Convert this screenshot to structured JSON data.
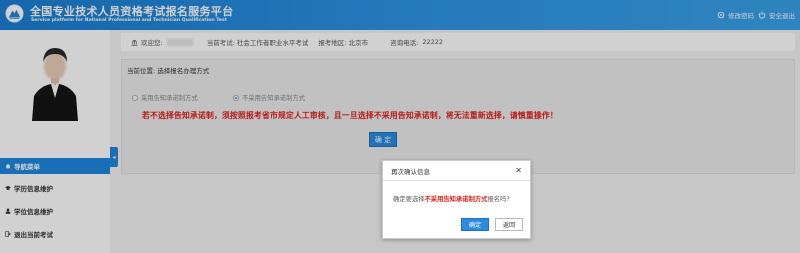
{
  "header": {
    "title": "全国专业技术人员资格考试报名服务平台",
    "subtitle": "Service platform for National Professional and Technician Qualification Test",
    "modify_password": "修改密码",
    "logout": "安全退出"
  },
  "sidebar": {
    "nav_head": "导航菜单",
    "items": [
      {
        "label": "学历信息维护",
        "icon": "graduation-cap-icon"
      },
      {
        "label": "学位信息维护",
        "icon": "user-icon"
      },
      {
        "label": "退出当前考试",
        "icon": "sign-out-icon"
      }
    ],
    "collapse_glyph": "◂"
  },
  "infobar": {
    "welcome_label": "欢迎您:",
    "current_exam_label": "当前考试:",
    "current_exam": "社会工作者职业水平考试",
    "region_label": "报考地区:",
    "region": "北京市",
    "phone_label": "咨询电话:",
    "phone": "22222"
  },
  "panel": {
    "location": "当前位置: 选择报名办理方式",
    "options": [
      {
        "label": "采用告知承诺制方式",
        "selected": false
      },
      {
        "label": "不采用告知承诺制方式",
        "selected": true
      }
    ],
    "warning": "若不选择告知承诺制，须按照报考省市规定人工审核，且一旦选择不采用告知承诺制，将无法重新选择，请慎重操作！",
    "confirm_label": "确 定"
  },
  "modal": {
    "title": "再次确认信息",
    "close_glyph": "✕",
    "body_prefix": "确定要选择",
    "body_emphasis": "不采用告知承诺制方式",
    "body_suffix": "报名吗?",
    "ok_label": "确定",
    "back_label": "返回"
  },
  "colors": {
    "primary": "#1e88df",
    "warning": "#e0201b",
    "header_gradient_start": "#1b7ed3",
    "header_gradient_end": "#3aa2ea"
  }
}
